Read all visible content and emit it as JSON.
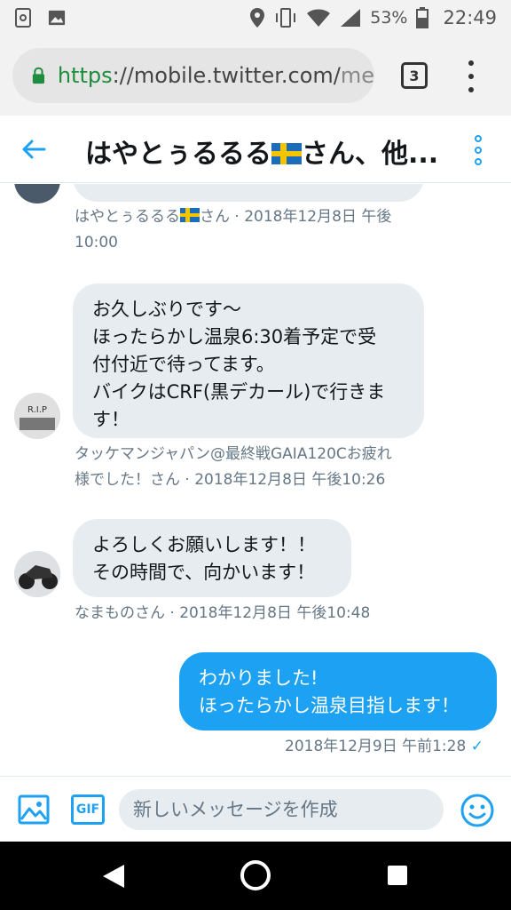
{
  "status_bar": {
    "battery": "53%",
    "time": "22:49",
    "icons": [
      "screenshot-icon",
      "image-icon",
      "location-icon",
      "vibrate-icon",
      "wifi-icon",
      "signal-icon",
      "battery-icon"
    ]
  },
  "browser": {
    "url_scheme": "https",
    "url_host": "://mobile.twitter.com/",
    "url_rest": "me",
    "tab_count": "3"
  },
  "header": {
    "title_prefix": "はやとぅるるる",
    "title_suffix": "さん、他..."
  },
  "messages": [
    {
      "direction": "in",
      "meta_name": "はやとぅるるる",
      "meta_rest": "さん · 2018年12月8日 午後",
      "meta_line2": "10:00"
    },
    {
      "direction": "in",
      "lines": [
        "お久しぶりです～",
        "ほったらかし温泉6:30着予定で受",
        "付付近で待ってます。",
        "バイクはCRF(黒デカール)で行きま",
        "す！"
      ],
      "meta_line1": "タッケマンジャパン@最終戦GAIA120Cお疲れ",
      "meta_line2": "様でした！さん · 2018年12月8日 午後10:26"
    },
    {
      "direction": "in",
      "lines": [
        "よろしくお願いします！！",
        "その時間で、向かいます！"
      ],
      "meta_line1": "なまものさん · 2018年12月8日 午後10:48"
    },
    {
      "direction": "out",
      "lines": [
        "わかりました!",
        "ほったらかし温泉目指します！"
      ],
      "meta_line1": "2018年12月9日 午前1:28",
      "read_mark": "✓"
    }
  ],
  "composer": {
    "gif_label": "GIF",
    "placeholder": "新しいメッセージを作成"
  },
  "colors": {
    "accent": "#1da1f2",
    "bubble_in": "#e6ecf0",
    "meta_text": "#657786"
  }
}
